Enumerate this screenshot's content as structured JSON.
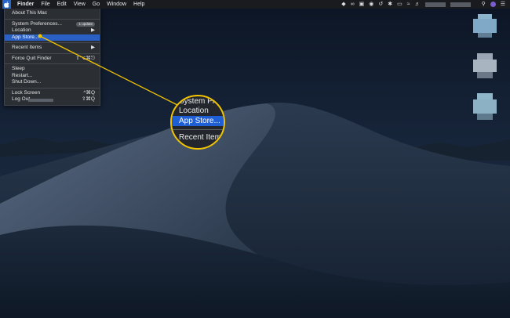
{
  "menubar": {
    "app_menu": "Finder",
    "items": [
      "File",
      "Edit",
      "View",
      "Go",
      "Window",
      "Help"
    ],
    "status_icons": [
      "dropbox-icon",
      "creative-cloud-icon",
      "display-icon",
      "time-machine-icon",
      "bluetooth-icon",
      "airplay-icon",
      "wifi-icon",
      "volume-icon",
      "search-icon",
      "siri-icon",
      "notification-icon"
    ]
  },
  "apple_menu": {
    "about": "About This Mac",
    "system_preferences": "System Preferences...",
    "system_preferences_badge": "1 update",
    "location": "Location",
    "app_store": "App Store...",
    "recent_items": "Recent Items",
    "force_quit": "Force Quit Finder",
    "force_quit_shortcut": "⇧⌥⌘⎋",
    "sleep": "Sleep",
    "restart": "Restart...",
    "shut_down": "Shut Down...",
    "lock_screen": "Lock Screen",
    "lock_screen_shortcut": "^⌘Q",
    "log_out": "Log Out",
    "log_out_shortcut": "⇧⌘Q",
    "submenu_arrow": "▶"
  },
  "zoom_callout": {
    "line1": "System Pr",
    "line2": "Location",
    "line3": "App Store...",
    "line4": "Recent Item",
    "highlight_color": "#1e5fd6",
    "ring_color": "#f2c400"
  }
}
